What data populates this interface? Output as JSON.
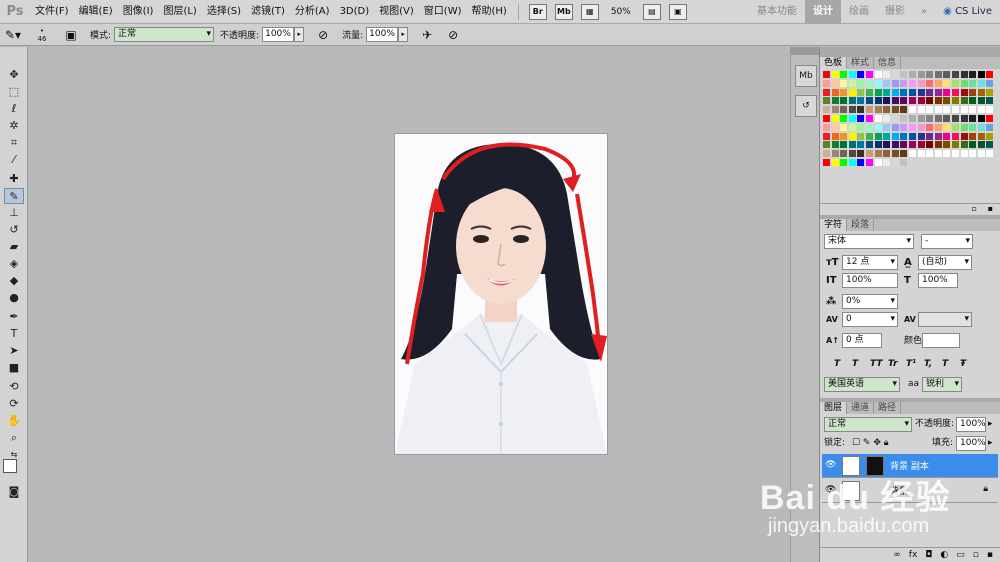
{
  "app": {
    "logo": "Ps"
  },
  "menu": [
    "文件(F)",
    "编辑(E)",
    "图像(I)",
    "图层(L)",
    "选择(S)",
    "滤镜(T)",
    "分析(A)",
    "3D(D)",
    "视图(V)",
    "窗口(W)",
    "帮助(H)"
  ],
  "toolbar_top": {
    "br_label": "Br",
    "mb_label": "Mb",
    "zoom": "50%"
  },
  "workspaces": {
    "basic": "基本功能",
    "design": "设计",
    "painting": "绘画",
    "photography": "摄影",
    "more": "»",
    "cslive": "CS Live"
  },
  "options": {
    "brush_size": "46",
    "mode_label": "模式:",
    "mode_value": "正常",
    "opacity_label": "不透明度:",
    "opacity_value": "100%",
    "flow_label": "流量:",
    "flow_value": "100%"
  },
  "panels": {
    "swatches_tabs": [
      "色板",
      "样式",
      "信息"
    ],
    "char_tabs": [
      "字符",
      "段落"
    ],
    "font_family": "宋体",
    "font_style": "-",
    "font_size": "12 点",
    "leading": "(自动)",
    "vscale": "100%",
    "hscale": "100%",
    "tracking_pct": "0%",
    "kerning": "0",
    "baseline": "0 点",
    "color_label": "颜色:",
    "format_buttons": [
      "T",
      "T",
      "TT",
      "Tr",
      "T¹",
      "T,",
      "T",
      "Ŧ"
    ],
    "language": "美国英语",
    "aa_label": "aa",
    "aa_value": "锐利",
    "layers_tabs": [
      "图层",
      "通道",
      "路径"
    ],
    "blend_mode": "正常",
    "layer_opacity_label": "不透明度:",
    "layer_opacity": "100%",
    "lock_label": "锁定:",
    "fill_label": "填充:",
    "fill_value": "100%",
    "layers": [
      {
        "name": "背景 副本",
        "selected": true
      },
      {
        "name": "背景",
        "selected": false
      }
    ]
  },
  "watermark": {
    "brand": "Bai du 经验",
    "url": "jingyan.baidu.com"
  },
  "colors": {
    "accent": "#3b8de9",
    "arrow_red": "#e02020"
  }
}
